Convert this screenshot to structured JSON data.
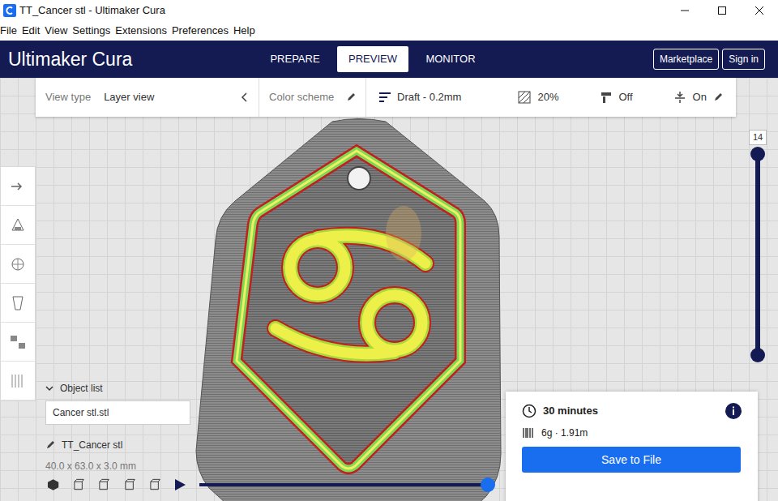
{
  "window": {
    "title": "TT_Cancer stl - Ultimaker Cura"
  },
  "menu": [
    "File",
    "Edit",
    "View",
    "Settings",
    "Extensions",
    "Preferences",
    "Help"
  ],
  "logo": "Ultimaker Cura",
  "stages": [
    {
      "label": "PREPARE",
      "selected": false
    },
    {
      "label": "PREVIEW",
      "selected": true
    },
    {
      "label": "MONITOR",
      "selected": false
    }
  ],
  "header_buttons": [
    "Marketplace",
    "Sign in"
  ],
  "view_bar": {
    "view_type_label": "View type",
    "view_type": "Layer view",
    "color_scheme": "Color scheme",
    "profile": "Draft - 0.2mm",
    "infill": "20%",
    "support": "Off",
    "adhesion": "On"
  },
  "layer_slider": {
    "value": "14",
    "level": 1
  },
  "object_list": {
    "header": "Object list",
    "expanded": true,
    "item": "Cancer stl.stl",
    "name": "TT_Cancer stl",
    "dimensions": "40.0 x 63.0 x 3.0 mm"
  },
  "playback": {
    "level": 1
  },
  "print_info": {
    "time": "30 minutes",
    "material": "6g · 1.91m",
    "action": "Save to File"
  }
}
